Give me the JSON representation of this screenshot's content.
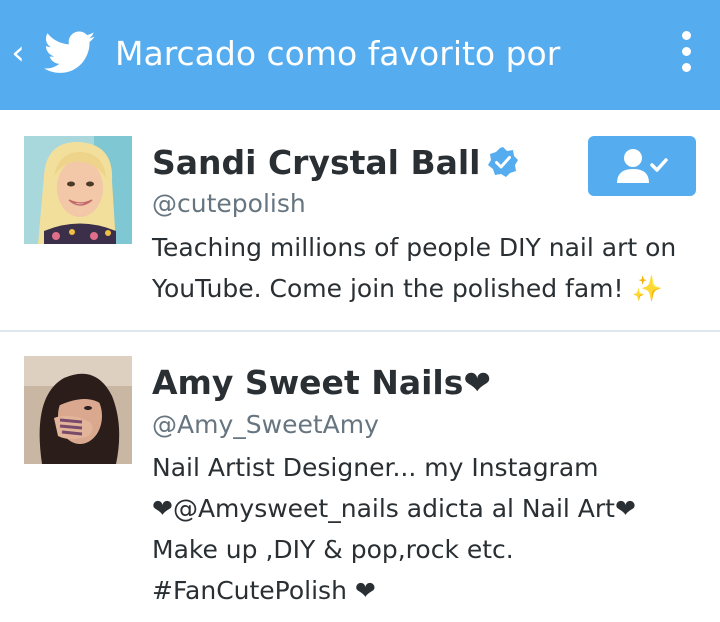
{
  "header": {
    "title": "Marcado como favorito por",
    "back_icon": "‹",
    "bg_color": "#55acee"
  },
  "users": [
    {
      "name": "Sandi Crystal Ball",
      "handle": "@cutepolish",
      "verified": true,
      "following": true,
      "bio_lines": [
        "Teaching millions of people DIY nail art on",
        "YouTube. Come join the polished fam! ✨"
      ]
    },
    {
      "name": "Amy Sweet Nails❤",
      "handle": "@Amy_SweetAmy",
      "verified": false,
      "bio_lines": [
        "Nail Artist Designer...  my Instagram",
        "❤@Amysweet_nails  adicta al Nail Art❤",
        "Make up ,DIY & pop,rock etc.",
        "#FanCutePolish ❤"
      ]
    }
  ],
  "colors": {
    "accent": "#55acee",
    "text_primary": "#292f33",
    "text_secondary": "#66757f",
    "divider": "#e1e8ed"
  },
  "icons": {
    "back": "back-arrow-icon",
    "logo": "twitter-bird-icon",
    "overflow": "overflow-menu-icon",
    "verified": "verified-badge-icon",
    "follow": "following-check-icon"
  }
}
